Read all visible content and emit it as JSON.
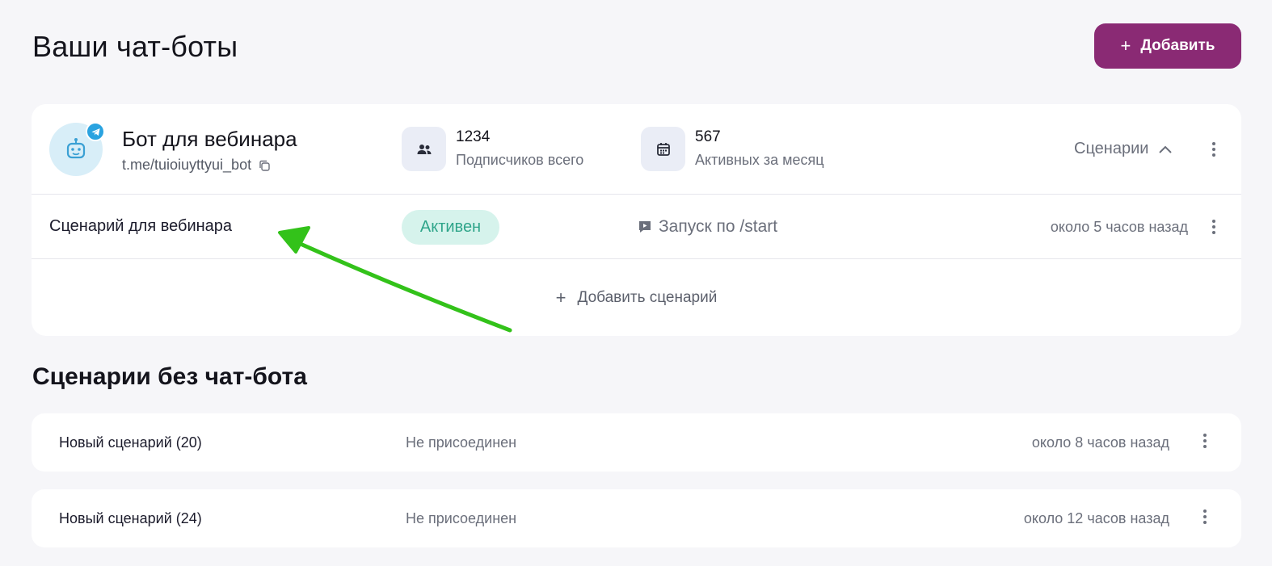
{
  "header": {
    "title": "Ваши чат-боты",
    "add_button": {
      "icon": "+",
      "label": "Добавить"
    }
  },
  "bot": {
    "name": "Бот для вебинара",
    "link": "t.me/tuioiuyttyui_bot",
    "avatar_icon": "robot-icon",
    "badge_icon": "telegram-icon",
    "stats": [
      {
        "icon": "users-icon",
        "value": "1234",
        "label": "Подписчиков всего"
      },
      {
        "icon": "calendar-icon",
        "value": "567",
        "label": "Активных за месяц"
      }
    ],
    "scenarios_toggle": "Сценарии",
    "scenario": {
      "name": "Сценарий для вебинара",
      "status": "Активен",
      "launch": "Запуск по /start",
      "time": "около 5 часов назад"
    },
    "add_scenario": "Добавить сценарий"
  },
  "orphan_section": {
    "title": "Сценарии без чат-бота",
    "items": [
      {
        "name": "Новый сценарий (20)",
        "status": "Не присоединен",
        "time": "около 8 часов назад"
      },
      {
        "name": "Новый сценарий (24)",
        "status": "Не присоединен",
        "time": "около 12 часов назад"
      }
    ]
  },
  "colors": {
    "accent": "#8a2a74",
    "active_badge_bg": "#d6f3ec",
    "active_badge_text": "#2fa58a",
    "annotation_arrow": "#33c21a",
    "background": "#f6f6f9"
  }
}
